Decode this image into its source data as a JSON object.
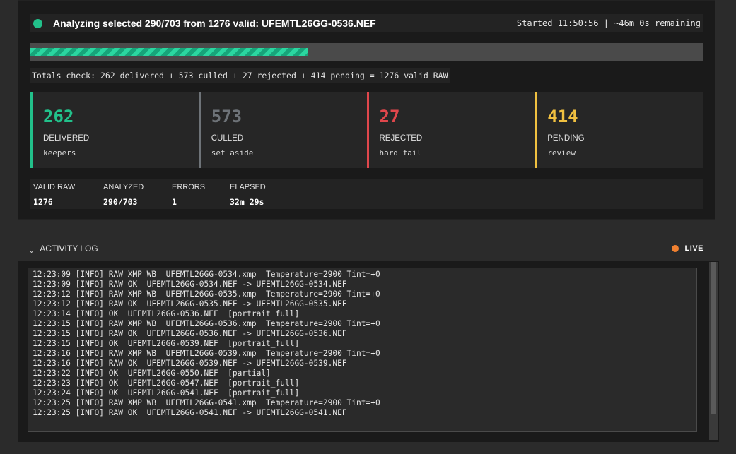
{
  "header": {
    "title": "Analyzing selected 290/703 from 1276 valid: UFEMTL26GG-0536.NEF",
    "status": "Started 11:50:56 | ~46m 0s remaining",
    "status_color": "#22c08a"
  },
  "progress": {
    "value": 0.412
  },
  "totals": "Totals check: 262 delivered + 573 culled + 27 rejected + 414 pending = 1276 valid RAW",
  "stats": [
    {
      "value": "262",
      "label": "DELIVERED",
      "sub": "keepers",
      "color": "#22c08a"
    },
    {
      "value": "573",
      "label": "CULLED",
      "sub": "set aside",
      "color": "#6e7378"
    },
    {
      "value": "27",
      "label": "REJECTED",
      "sub": "hard fail",
      "color": "#e0474c"
    },
    {
      "value": "414",
      "label": "PENDING",
      "sub": "review",
      "color": "#f0c040"
    }
  ],
  "meta": [
    {
      "key": "VALID RAW",
      "value": "1276"
    },
    {
      "key": "ANALYZED",
      "value": "290/703"
    },
    {
      "key": "ERRORS",
      "value": "1"
    },
    {
      "key": "ELAPSED",
      "value": "32m 29s"
    }
  ],
  "log": {
    "chevron": "⌄",
    "title": "ACTIVITY LOG",
    "live": "LIVE",
    "lines": [
      "12:23:09 [INFO] RAW XMP WB  UFEMTL26GG-0534.xmp  Temperature=2900 Tint=+0",
      "12:23:09 [INFO] RAW OK  UFEMTL26GG-0534.NEF -> UFEMTL26GG-0534.NEF",
      "12:23:12 [INFO] RAW XMP WB  UFEMTL26GG-0535.xmp  Temperature=2900 Tint=+0",
      "12:23:12 [INFO] RAW OK  UFEMTL26GG-0535.NEF -> UFEMTL26GG-0535.NEF",
      "12:23:14 [INFO] OK  UFEMTL26GG-0536.NEF  [portrait_full]",
      "12:23:15 [INFO] RAW XMP WB  UFEMTL26GG-0536.xmp  Temperature=2900 Tint=+0",
      "12:23:15 [INFO] RAW OK  UFEMTL26GG-0536.NEF -> UFEMTL26GG-0536.NEF",
      "12:23:15 [INFO] OK  UFEMTL26GG-0539.NEF  [portrait_full]",
      "12:23:16 [INFO] RAW XMP WB  UFEMTL26GG-0539.xmp  Temperature=2900 Tint=+0",
      "12:23:16 [INFO] RAW OK  UFEMTL26GG-0539.NEF -> UFEMTL26GG-0539.NEF",
      "12:23:22 [INFO] OK  UFEMTL26GG-0550.NEF  [partial]",
      "12:23:23 [INFO] OK  UFEMTL26GG-0547.NEF  [portrait_full]",
      "12:23:24 [INFO] OK  UFEMTL26GG-0541.NEF  [portrait_full]",
      "12:23:25 [INFO] RAW XMP WB  UFEMTL26GG-0541.xmp  Temperature=2900 Tint=+0",
      "12:23:25 [INFO] RAW OK  UFEMTL26GG-0541.NEF -> UFEMTL26GG-0541.NEF"
    ]
  }
}
